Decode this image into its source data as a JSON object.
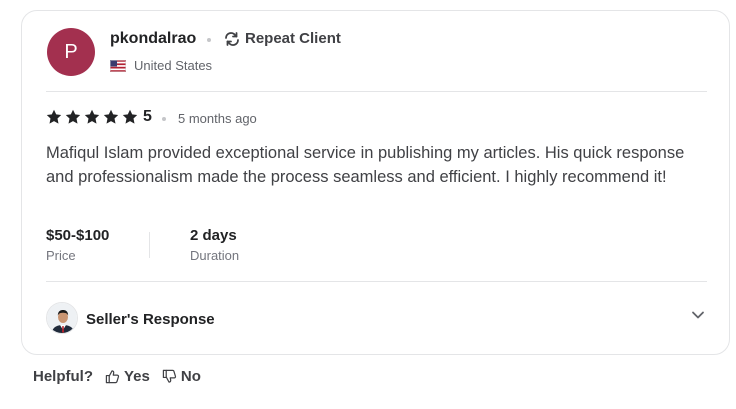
{
  "review": {
    "avatar_initial": "P",
    "username": "pkondalrao",
    "badge_label": "Repeat Client",
    "country": "United States",
    "rating_value": "5",
    "stars_filled": 5,
    "time_ago": "5 months ago",
    "text": "Mafiqul Islam provided exceptional service in publishing my articles. His quick response and professionalism made the process seamless and efficient. I highly recommend it!",
    "price": {
      "value": "$50-$100",
      "label": "Price"
    },
    "duration": {
      "value": "2 days",
      "label": "Duration"
    },
    "seller_response_label": "Seller's Response"
  },
  "helpful": {
    "label": "Helpful?",
    "yes_label": "Yes",
    "no_label": "No"
  },
  "colors": {
    "avatar_bg": "#a3304f",
    "text_primary": "#222325",
    "text_secondary": "#62646a",
    "border": "#e4e5e7"
  },
  "icons": [
    "repeat-icon",
    "us-flag-icon",
    "star-icon",
    "chevron-down-icon",
    "thumbs-up-icon",
    "thumbs-down-icon"
  ]
}
